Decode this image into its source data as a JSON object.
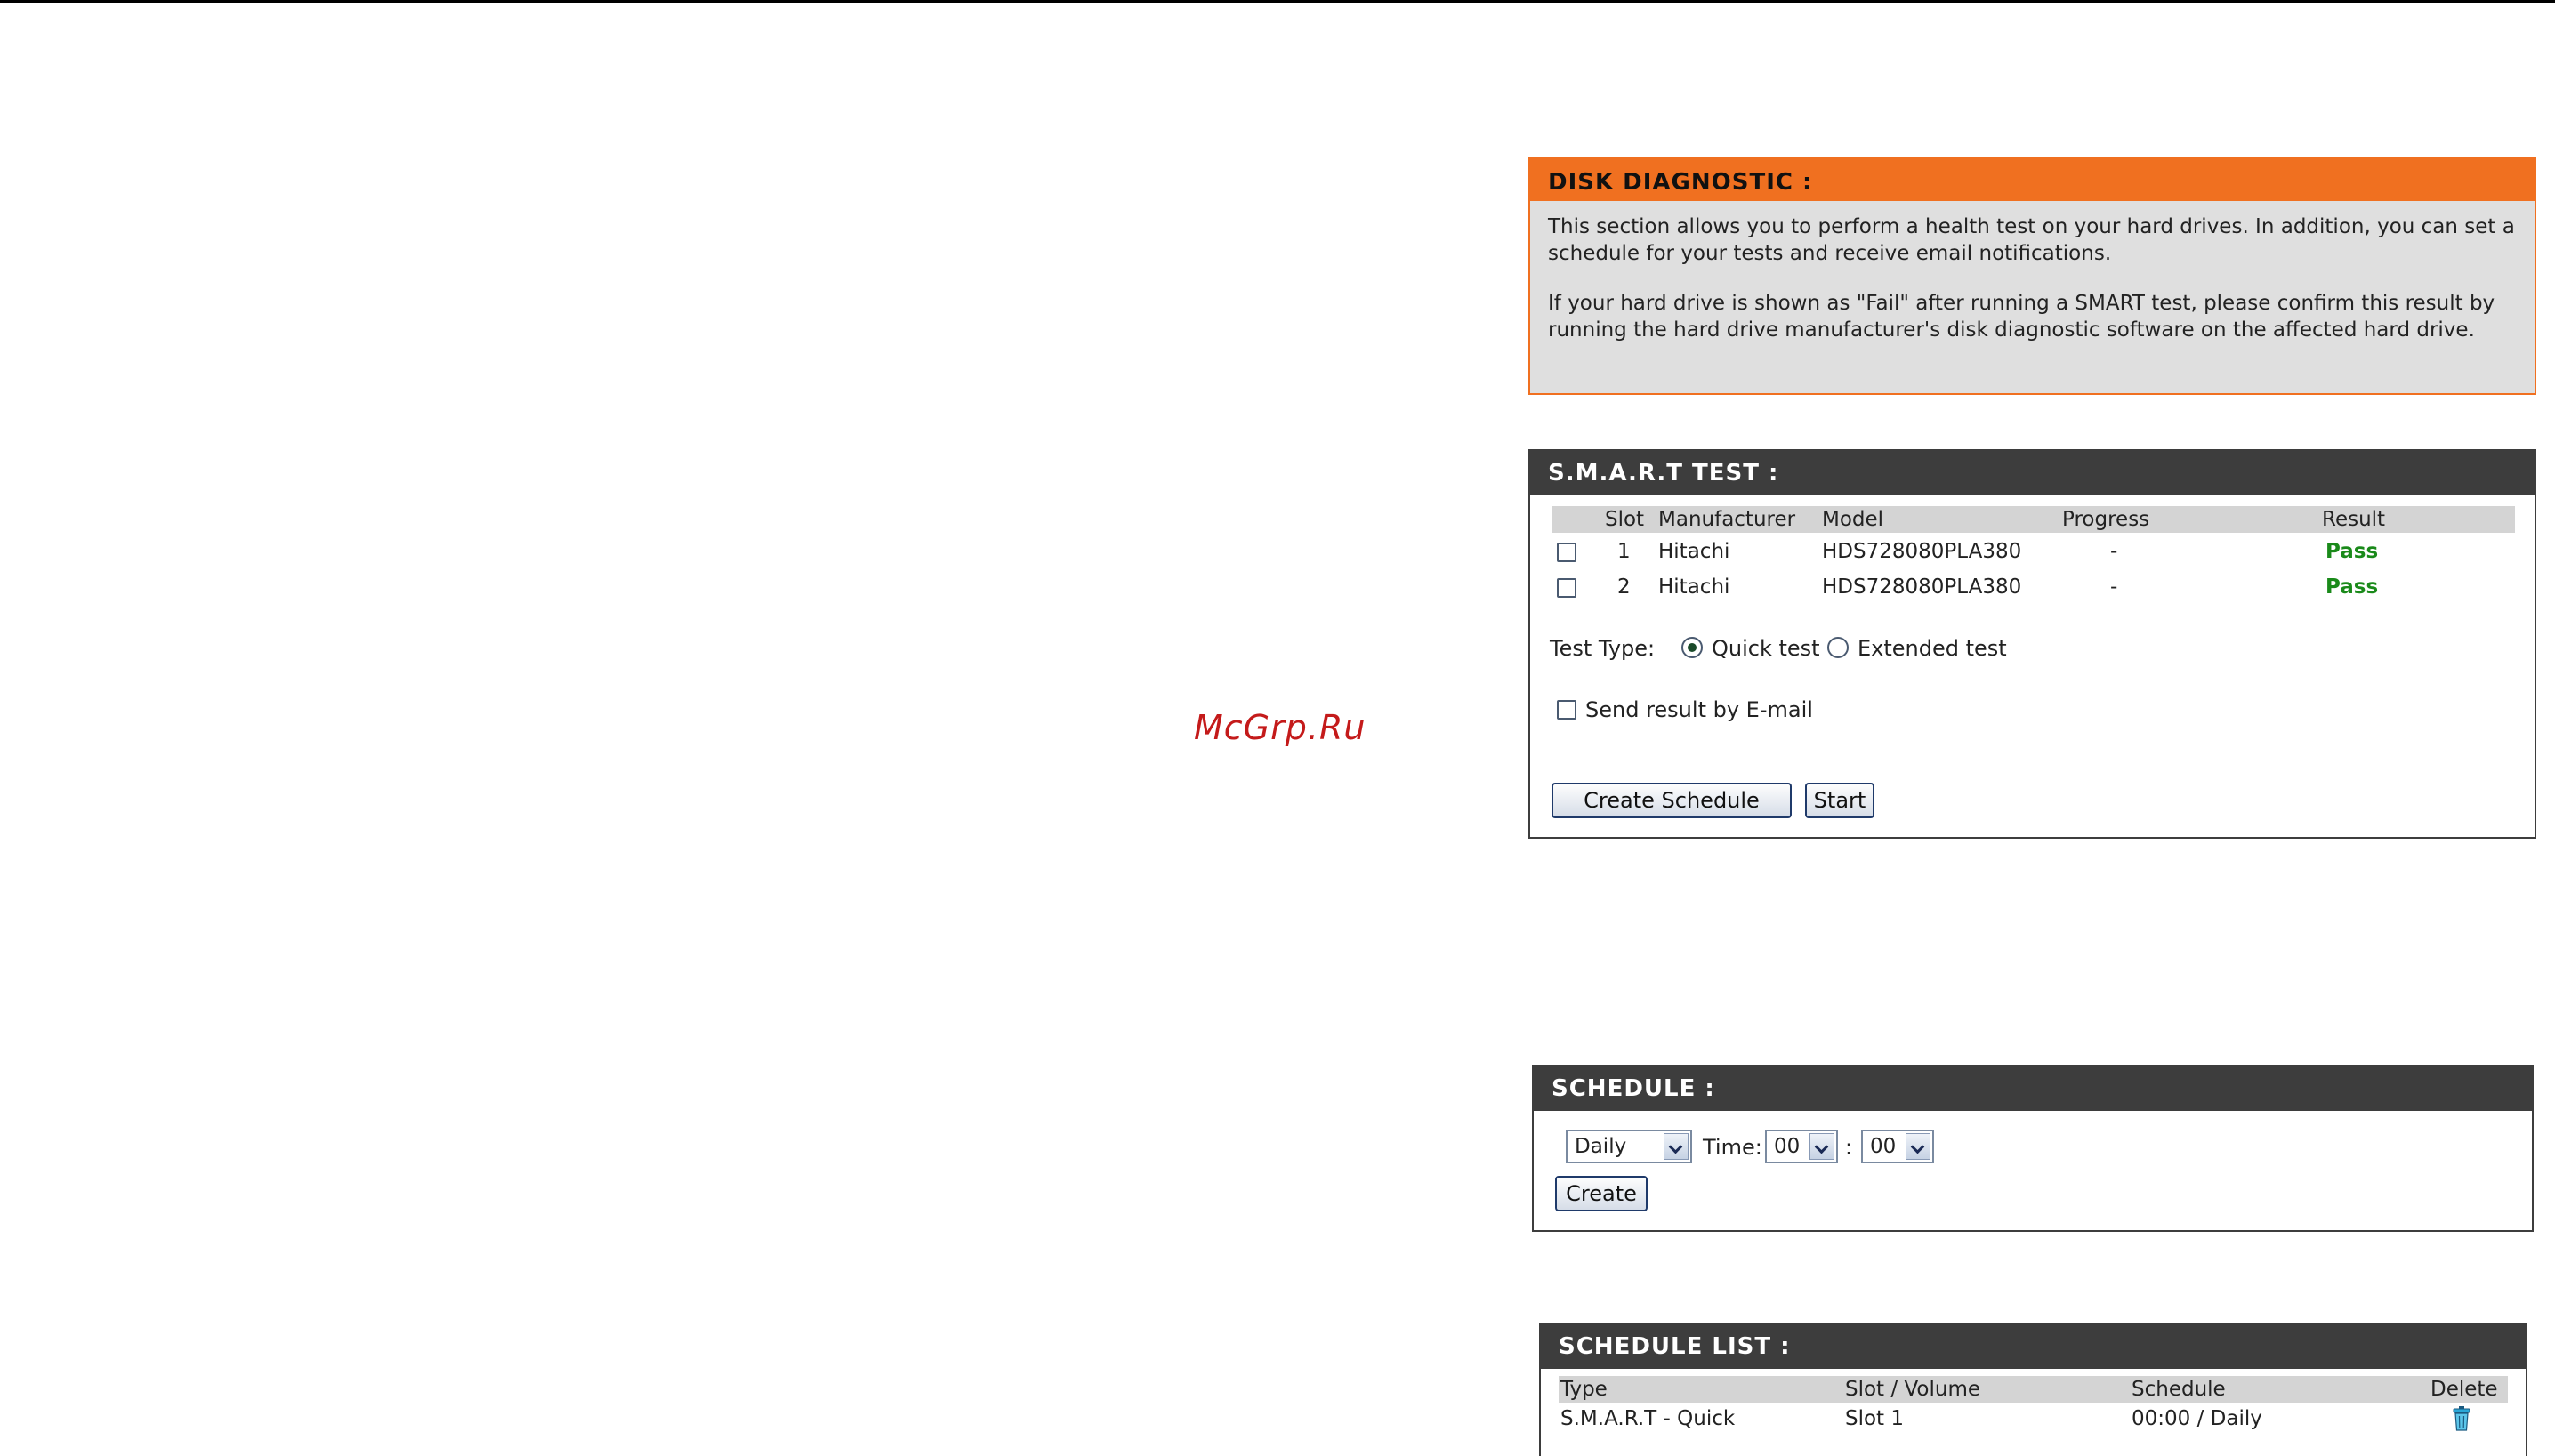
{
  "watermark": "McGrp.Ru",
  "diagnostic": {
    "title": "DISK DIAGNOSTIC :",
    "para1_line1": "This section allows you to perform a health test on your hard drives. In addition, you can set a",
    "para1_line2": "schedule for your tests and receive email notifications.",
    "para2_line1": "If your hard drive is shown as \"Fail\" after running a SMART test, please confirm this result by",
    "para2_line2": "running the hard drive manufacturer's disk diagnostic software on the affected hard drive."
  },
  "smart": {
    "title": "S.M.A.R.T TEST :",
    "columns": [
      "Slot",
      "Manufacturer",
      "Model",
      "Progress",
      "Result"
    ],
    "rows": [
      {
        "slot": "1",
        "manufacturer": "Hitachi",
        "model": "HDS728080PLA380",
        "progress": "-",
        "result": "Pass"
      },
      {
        "slot": "2",
        "manufacturer": "Hitachi",
        "model": "HDS728080PLA380",
        "progress": "-",
        "result": "Pass"
      }
    ],
    "test_type_label": "Test Type:",
    "quick_test": "Quick test",
    "extended_test": "Extended test",
    "send_email": "Send result by E-mail",
    "create_schedule": "Create Schedule",
    "start": "Start"
  },
  "schedule": {
    "title": "SCHEDULE :",
    "frequency": "Daily",
    "time_label": "Time:",
    "hour": "00",
    "separator": ":",
    "minute": "00",
    "create": "Create"
  },
  "schedule_list": {
    "title": "SCHEDULE LIST :",
    "columns": [
      "Type",
      "Slot / Volume",
      "Schedule",
      "Delete"
    ],
    "rows": [
      {
        "type": "S.M.A.R.T - Quick",
        "slot": "Slot 1",
        "schedule": "00:00 / Daily"
      }
    ]
  },
  "colors": {
    "accent": "#f07020",
    "header": "#3d3d3d",
    "pass": "#1a8a1a"
  }
}
